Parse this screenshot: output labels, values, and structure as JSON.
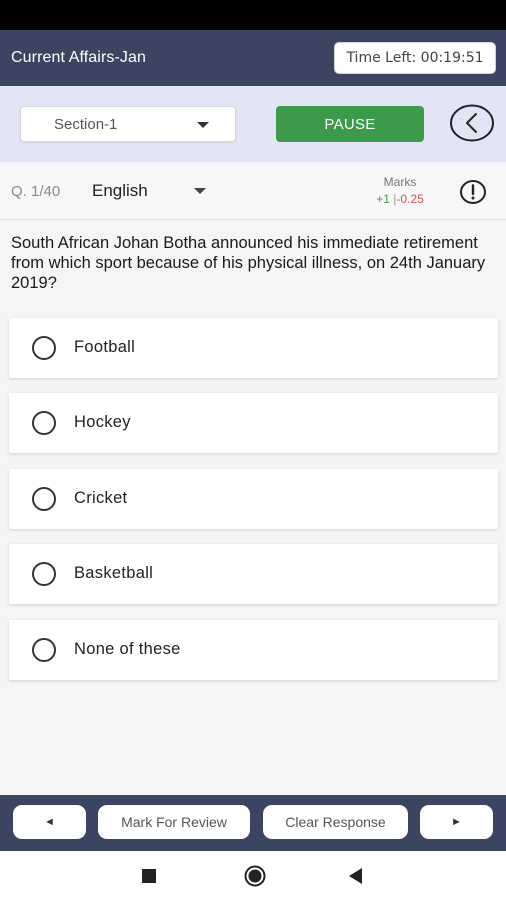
{
  "header": {
    "title": "Current Affairs-Jan",
    "timer": "Time Left: 00:19:51"
  },
  "toolbar": {
    "section": "Section-1",
    "pause_label": "PAUSE"
  },
  "question_meta": {
    "number": "Q. 1/40",
    "language": "English",
    "marks_label": "Marks",
    "marks_positive": "+1",
    "marks_separator": "|",
    "marks_negative": "-0.25"
  },
  "question": {
    "text": "South African Johan Botha announced his immediate retirement from which sport because of his physical illness, on 24th January 2019?"
  },
  "options": [
    {
      "label": "Football"
    },
    {
      "label": "Hockey"
    },
    {
      "label": "Cricket"
    },
    {
      "label": "Basketball"
    },
    {
      "label": "None of these"
    }
  ],
  "bottom_bar": {
    "prev_label": "◄",
    "review_label": "Mark For Review",
    "clear_label": "Clear Response",
    "next_label": "►"
  },
  "icons": {
    "back": "chevron-left-icon",
    "info": "exclamation-circle-icon",
    "dropdown": "caret-down-icon"
  },
  "colors": {
    "header_bg": "#3b4461",
    "toolbar_bg": "#e3e5f6",
    "pause_bg": "#3c9a4a",
    "marks_positive": "#3c9a4a",
    "marks_negative": "#d9534f"
  }
}
